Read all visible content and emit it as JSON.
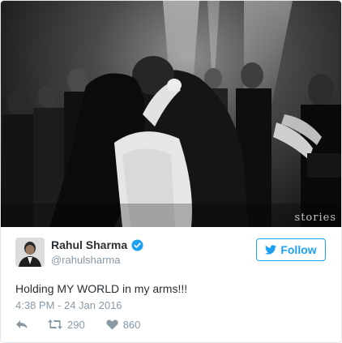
{
  "photo": {
    "description_icon": "wedding-photo",
    "watermark": "stories"
  },
  "author": {
    "name": "Rahul Sharma",
    "handle": "@rahulsharma",
    "verified_icon": "verified-badge-icon"
  },
  "follow": {
    "label": "Follow",
    "icon": "twitter-bird-icon",
    "color": "#1da1f2"
  },
  "tweet": {
    "text": "Holding MY WORLD in my arms!!!",
    "timestamp": "4:38 PM - 24 Jan 2016"
  },
  "actions": {
    "reply_icon": "reply-icon",
    "retweet_icon": "retweet-icon",
    "retweet_count": "290",
    "like_icon": "heart-icon",
    "like_count": "860"
  }
}
